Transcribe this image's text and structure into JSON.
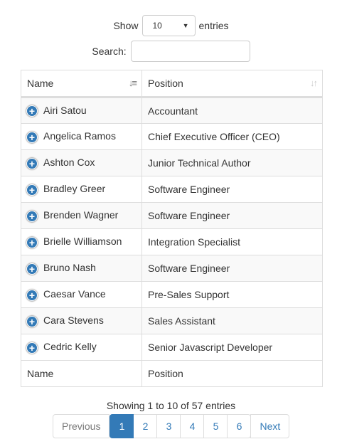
{
  "length_menu": {
    "show_label": "Show",
    "selected": "10",
    "entries_label": "entries"
  },
  "search": {
    "label": "Search:",
    "value": ""
  },
  "table": {
    "columns": [
      {
        "label": "Name",
        "sort": "ascending"
      },
      {
        "label": "Position",
        "sort": "none"
      }
    ],
    "rows": [
      {
        "name": "Airi Satou",
        "position": "Accountant"
      },
      {
        "name": "Angelica Ramos",
        "position": "Chief Executive Officer (CEO)"
      },
      {
        "name": "Ashton Cox",
        "position": "Junior Technical Author"
      },
      {
        "name": "Bradley Greer",
        "position": "Software Engineer"
      },
      {
        "name": "Brenden Wagner",
        "position": "Software Engineer"
      },
      {
        "name": "Brielle Williamson",
        "position": "Integration Specialist"
      },
      {
        "name": "Bruno Nash",
        "position": "Software Engineer"
      },
      {
        "name": "Caesar Vance",
        "position": "Pre-Sales Support"
      },
      {
        "name": "Cara Stevens",
        "position": "Sales Assistant"
      },
      {
        "name": "Cedric Kelly",
        "position": "Senior Javascript Developer"
      }
    ],
    "footer": [
      "Name",
      "Position"
    ]
  },
  "info": "Showing 1 to 10 of 57 entries",
  "pagination": {
    "previous": "Previous",
    "pages": [
      "1",
      "2",
      "3",
      "4",
      "5",
      "6"
    ],
    "active_page": "1",
    "next": "Next"
  },
  "colors": {
    "accent": "#337ab7",
    "border": "#dddddd",
    "stripe": "#f9f9f9"
  },
  "icons": {
    "expand": "plus-circle-icon",
    "sort_asc": "sort-ascending-icon",
    "sort_both": "sort-both-icon"
  }
}
